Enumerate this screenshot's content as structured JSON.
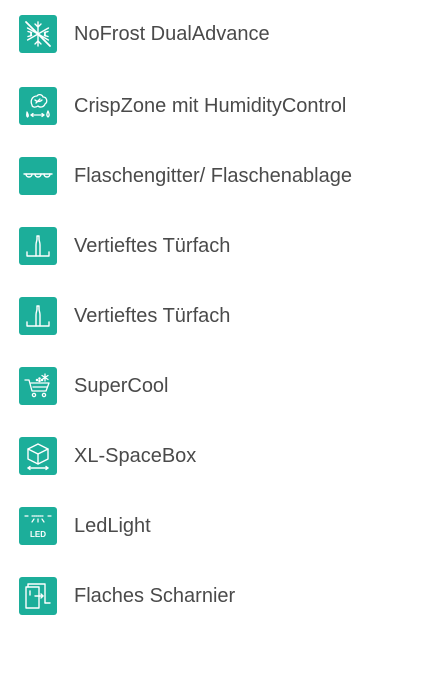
{
  "theme": {
    "accent": "#1cae9a",
    "text": "#4a4a4a",
    "icon_stroke": "#ffffff"
  },
  "features": [
    {
      "label": "NoFrost DualAdvance",
      "icon": "snowflake-crossed-icon"
    },
    {
      "label": "CrispZone mit HumidityControl",
      "icon": "humidity-control-icon"
    },
    {
      "label": "Flaschengitter/ Flaschenablage",
      "icon": "bottle-rack-icon"
    },
    {
      "label": "Vertieftes Türfach",
      "icon": "door-shelf-icon"
    },
    {
      "label": "Vertieftes Türfach",
      "icon": "door-shelf-icon"
    },
    {
      "label": "SuperCool",
      "icon": "supercool-cart-icon"
    },
    {
      "label": "XL-SpaceBox",
      "icon": "space-box-icon"
    },
    {
      "label": "LedLight",
      "icon": "led-light-icon",
      "icon_text": "LED"
    },
    {
      "label": "Flaches Scharnier",
      "icon": "flat-hinge-icon"
    }
  ]
}
